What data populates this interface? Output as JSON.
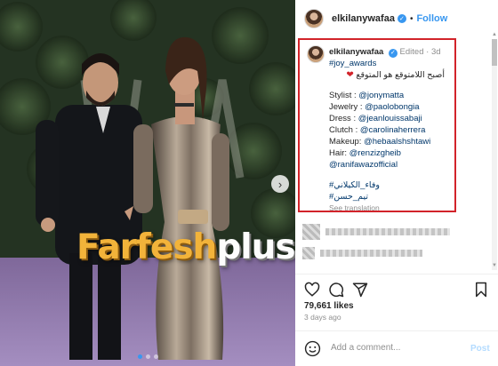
{
  "post": {
    "username": "elkilanywafaa",
    "follow_label": "Follow",
    "dot": "•"
  },
  "caption": {
    "username": "elkilanywafaa",
    "edited": "Edited",
    "separator": "·",
    "age": "3d",
    "hashtag1": "#joy_awards",
    "arabic_line": "أصبح اللامتوقع هو المتوقع",
    "credits": [
      {
        "label": "Stylist : ",
        "handle": "@jonymatta"
      },
      {
        "label": "Jewelry : ",
        "handle": "@paolobongia"
      },
      {
        "label": "Dress : ",
        "handle": "@jeanlouissabaji"
      },
      {
        "label": "Clutch : ",
        "handle": "@carolinaherrera"
      },
      {
        "label": "Makeup: ",
        "handle": "@hebaalshshtawi"
      },
      {
        "label": "Hair: ",
        "handle": "@renzizgheib"
      },
      {
        "label": "",
        "handle": "@ranifawazofficial"
      }
    ],
    "hashtag_ar1": "#وفاء_الكيلاني",
    "hashtag_ar2": "#تيم_حسن",
    "see_translation": "See translation"
  },
  "watermark": {
    "main": "Farfesh",
    "plus": "plus.com"
  },
  "carousel": {
    "next_glyph": "›",
    "dots": 3,
    "active_dot": 1
  },
  "engagement": {
    "likes": "79,661 likes",
    "time_ago": "3 days ago"
  },
  "comment_box": {
    "placeholder": "Add a comment...",
    "post_label": "Post"
  },
  "icons": {
    "heart": "heart-icon",
    "comment": "comment-icon",
    "share": "share-icon",
    "save": "bookmark-icon",
    "emoji": "emoji-icon",
    "verified": "verified-badge-icon"
  },
  "colors": {
    "highlight_border": "#d2232a",
    "link_blue": "#00376b",
    "follow_blue": "#3897f0",
    "watermark_gold": "#f2b33a"
  }
}
